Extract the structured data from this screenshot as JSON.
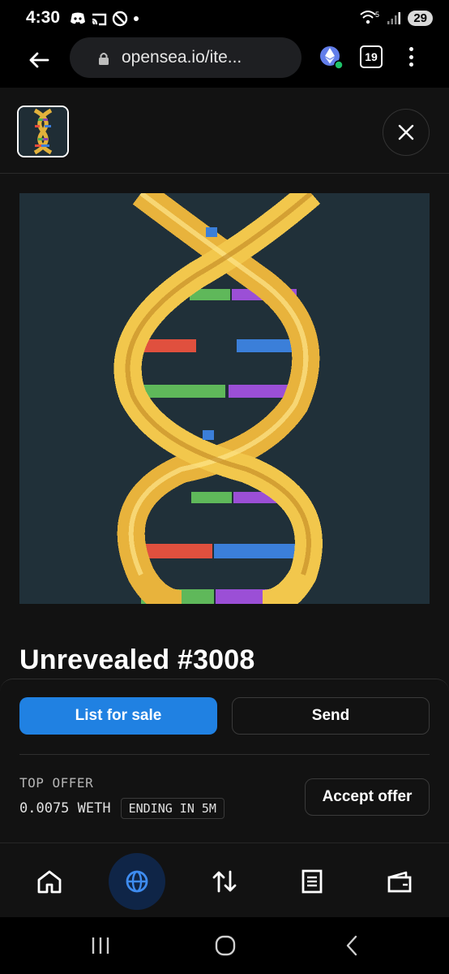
{
  "status_bar": {
    "time": "4:30",
    "network": "5",
    "battery": "29",
    "icons": [
      "discord-icon",
      "cast-icon",
      "dnd-off-icon",
      "dot-icon"
    ]
  },
  "browser": {
    "url": "opensea.io/ite...",
    "tab_count": "19",
    "extension_icon": "ethereum-icon"
  },
  "nft": {
    "title": "Unrevealed #3008",
    "image_desc_icon": "dna-pixel-art"
  },
  "actions": {
    "list_for_sale": "List for sale",
    "send": "Send",
    "accept_offer": "Accept offer"
  },
  "offer": {
    "label": "TOP OFFER",
    "value": "0.0075 WETH",
    "ending": "ENDING IN 5M"
  },
  "bottom_nav": {
    "items": [
      "home-icon",
      "globe-icon",
      "swap-icon",
      "list-icon",
      "wallet-icon"
    ],
    "active": "globe-icon"
  },
  "colors": {
    "primary_blue": "#2081e2",
    "background": "#121212",
    "active_nav": "#0f2547"
  }
}
